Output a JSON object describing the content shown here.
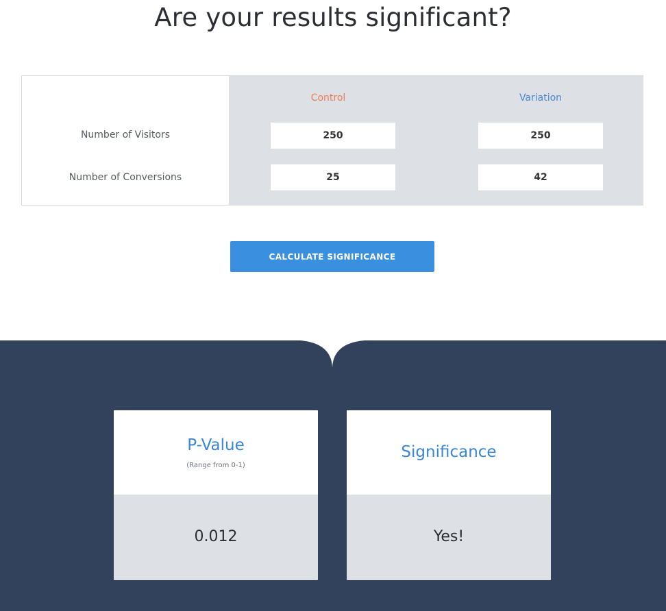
{
  "page": {
    "title": "Are your results significant?"
  },
  "form": {
    "columns": {
      "control": "Control",
      "variation": "Variation"
    },
    "rows": {
      "visitors_label": "Number of Visitors",
      "conversions_label": "Number of Conversions"
    },
    "values": {
      "control_visitors": "250",
      "variation_visitors": "250",
      "control_conversions": "25",
      "variation_conversions": "42"
    },
    "calculate_label": "CALCULATE SIGNIFICANCE"
  },
  "results": {
    "pvalue": {
      "title": "P-Value",
      "subtitle": "(Range from 0-1)",
      "value": "0.012"
    },
    "significance": {
      "title": "Significance",
      "value": "Yes!"
    }
  },
  "colors": {
    "control": "#f07b4f",
    "variation": "#4a86d6",
    "button": "#3a8fdf",
    "results_bg": "#32425c",
    "panel": "#dde0e5"
  }
}
